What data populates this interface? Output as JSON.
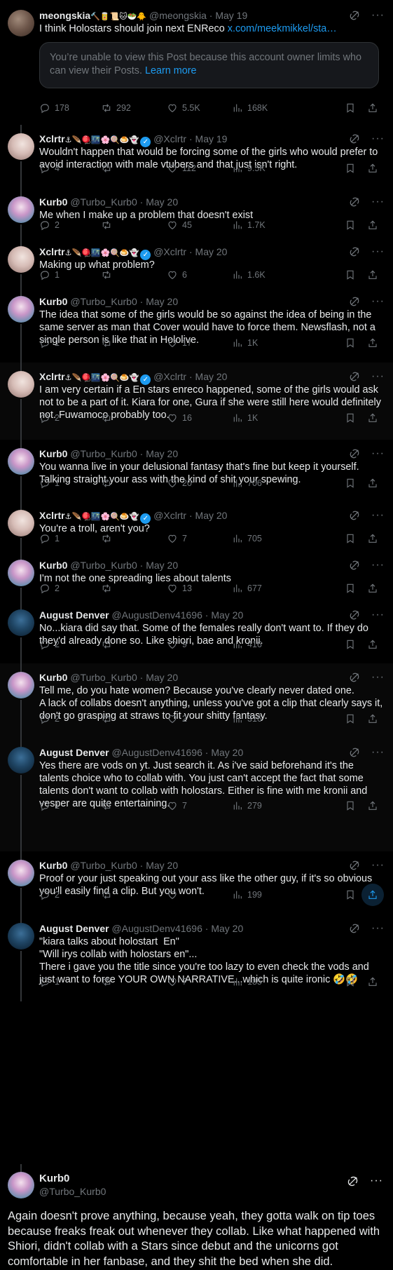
{
  "tweets": [
    {
      "name": "meongskia",
      "emoji": "🔨🥫📜🐱🥗🐥",
      "handle": "@meongskia",
      "date": "· May 19",
      "text_prefix": "I think Holostars should join next ENReco ",
      "link": "x.com/meekmikkel/sta…",
      "notice": "You’re unable to view this Post because this account owner limits who can view their Posts. ",
      "notice_link": "Learn more",
      "replies": "178",
      "reposts": "292",
      "likes": "5.5K",
      "views": "168K"
    },
    {
      "name": "Xclrtr",
      "emoji": "⚓🪶🪀🌃🌸🍭🍮👻",
      "handle": "@Xclrtr",
      "date": "· May 19",
      "text": "Wouldn't happen that would be forcing some of the girls who would prefer to avoid interaction with male vtubers and that just isn't right.",
      "replies": "4",
      "reposts": "",
      "likes": "112",
      "views": "9.5K"
    },
    {
      "name": "Kurb0",
      "handle": "@Turbo_Kurb0",
      "date": "· May 20",
      "text": "Me when I make up a problem that doesn't exist",
      "replies": "2",
      "reposts": "",
      "likes": "45",
      "views": "1.7K"
    },
    {
      "name": "Xclrtr",
      "emoji": "⚓🪶🪀🌃🌸🍭🍮👻",
      "handle": "@Xclrtr",
      "date": "· May 20",
      "text": "Making up what problem?",
      "replies": "1",
      "reposts": "",
      "likes": "6",
      "views": "1.6K"
    },
    {
      "name": "Kurb0",
      "handle": "@Turbo_Kurb0",
      "date": "· May 20",
      "text": "The idea that some of the girls would be so against the idea of being in the same server as man that Cover would have to force them. Newsflash, not a single person is like that in Hololive.",
      "replies": "1",
      "reposts": "",
      "likes": "17",
      "views": "1K"
    },
    {
      "name": "Xclrtr",
      "emoji": "⚓🪶🪀🌃🌸🍭🍮👻",
      "handle": "@Xclrtr",
      "date": "· May 20",
      "text": "I am very certain if a En stars enreco happened, some of the girls would ask not to be a part of it. Kiara for one, Gura if she were still here would definitely not. Fuwamoco probably too.",
      "replies": "2",
      "reposts": "",
      "likes": "16",
      "views": "1K"
    },
    {
      "name": "Kurb0",
      "handle": "@Turbo_Kurb0",
      "date": "· May 20",
      "text": "You wanna live in your delusional fantasy that's fine but keep it yourself. Talking straight your ass with the kind of shit your spewing.",
      "replies": "1",
      "reposts": "",
      "likes": "20",
      "views": "706"
    },
    {
      "name": "Xclrtr",
      "emoji": "⚓🪶🪀🌃🌸🍭🍮👻",
      "handle": "@Xclrtr",
      "date": "· May 20",
      "text": "You're a troll, aren't you?",
      "replies": "1",
      "reposts": "",
      "likes": "7",
      "views": "705"
    },
    {
      "name": "Kurb0",
      "handle": "@Turbo_Kurb0",
      "date": "· May 20",
      "text": "I'm not the one spreading lies about talents",
      "replies": "2",
      "reposts": "",
      "likes": "13",
      "views": "677"
    },
    {
      "name": "August Denver",
      "handle": "@AugustDenv41696",
      "date": "· May 20",
      "text": "No...kiara did say that. Some of the females really don't want to. If they do they'd already done so. Like shiori, bae and kronii.",
      "replies": "2",
      "reposts": "",
      "likes": "9",
      "views": "416"
    },
    {
      "name": "Kurb0",
      "handle": "@Turbo_Kurb0",
      "date": "· May 20",
      "text": "Tell me, do you hate women? Because you've clearly never dated one.\nA lack of collabs doesn't anything, unless you've got a clip that clearly says it, don't go grasping at straws to fit your shitty fantasy.",
      "replies": "2",
      "reposts": "",
      "likes": "2",
      "views": "316"
    },
    {
      "name": "August Denver",
      "handle": "@AugustDenv41696",
      "date": "· May 20",
      "text": "Yes there are vods on yt. Just search it. As i've said beforehand it's the talents choice who to collab with. You just can't accept the fact that some talents don't want to collab with holostars. Either is fine with me kronii and vesper are quite entertaining.",
      "replies": "1",
      "reposts": "",
      "likes": "7",
      "views": "279"
    },
    {
      "name": "Kurb0",
      "handle": "@Turbo_Kurb0",
      "date": "· May 20",
      "text": "Proof or your just speaking out your ass like the other guy, if it's so obvious you'll easily find a clip. But you won't.",
      "replies": "2",
      "reposts": "",
      "likes": "",
      "views": "199"
    },
    {
      "name": "August Denver",
      "handle": "@AugustDenv41696",
      "date": "· May 20",
      "text": "\"kiara talks about holostart  En\"\n\"Will irys collab with holostars en\"...\nThere i gave you the title since you're too lazy to even check the vods and just want to force YOUR OWN NARRATIVE...which is quite ironic 🤣🤣",
      "replies": "1",
      "reposts": "",
      "likes": "7",
      "views": "185"
    }
  ],
  "main": {
    "name": "Kurb0",
    "handle": "@Turbo_Kurb0",
    "text": "Again doesn't prove anything, because yeah, they gotta walk on tip toes because freaks freak out whenever they collab. Like what happened with Shiori, didn't collab with a Stars since debut and the unicorns got comfortable in her fanbase, and they shit the bed when she did."
  }
}
